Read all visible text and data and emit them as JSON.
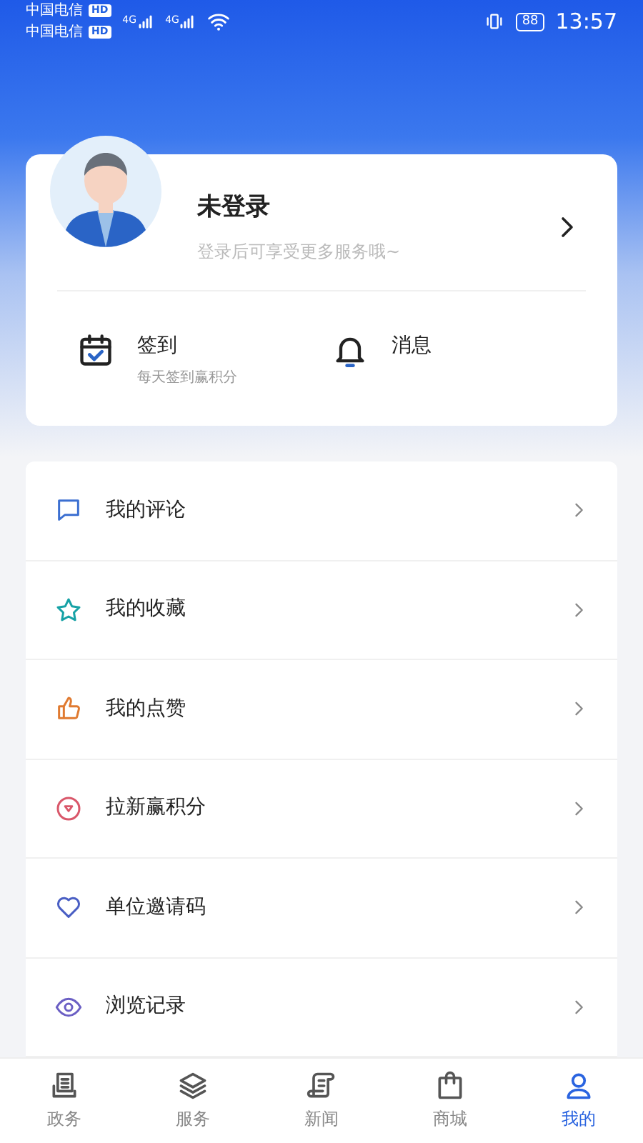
{
  "status_bar": {
    "carriers": [
      {
        "name": "中国电信",
        "badge": "HD"
      },
      {
        "name": "中国电信",
        "badge": "HD"
      }
    ],
    "networks": [
      "4G",
      "4G"
    ],
    "battery": "88",
    "time": "13:57"
  },
  "profile": {
    "name": "未登录",
    "hint": "登录后可享受更多服务哦~"
  },
  "quick_actions": [
    {
      "kind": "checkin",
      "title": "签到",
      "subtitle": "每天签到赢积分"
    },
    {
      "kind": "bell",
      "title": "消息"
    }
  ],
  "menu": [
    {
      "kind": "comment",
      "label": "我的评论",
      "color": "#3b6fd1"
    },
    {
      "kind": "star",
      "label": "我的收藏",
      "color": "#17a2a6"
    },
    {
      "kind": "thumb",
      "label": "我的点赞",
      "color": "#e07a30"
    },
    {
      "kind": "coin",
      "label": "拉新赢积分",
      "color": "#d9576a"
    },
    {
      "kind": "heart",
      "label": "单位邀请码",
      "color": "#4a5fc4"
    },
    {
      "kind": "eye",
      "label": "浏览记录",
      "color": "#6b5fc4"
    }
  ],
  "tab_bar": [
    {
      "kind": "affairs",
      "label": "政务",
      "selected": false
    },
    {
      "kind": "layers",
      "label": "服务",
      "selected": false
    },
    {
      "kind": "news",
      "label": "新闻",
      "selected": false
    },
    {
      "kind": "mall",
      "label": "商城",
      "selected": false
    },
    {
      "kind": "user",
      "label": "我的",
      "selected": true
    }
  ]
}
